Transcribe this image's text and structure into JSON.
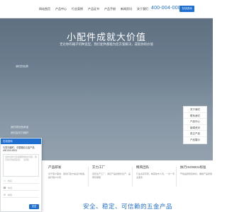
{
  "nav": {
    "items": [
      "网站首页",
      "产品中心",
      "行业案例",
      "产品证书",
      "产品手册",
      "新闻资讯",
      "关于我们"
    ],
    "phone": "400-004-0003",
    "online_button": "在线咨询"
  },
  "hero": {
    "title": "小配件成就大价值",
    "subtitle": "无论你的箱子何种造型，我们配件都能为您方案解决，成就你的价值",
    "lines": [
      "我们的优势",
      "我们将仍然承诺",
      "我们会尽力做好"
    ]
  },
  "float_menu": [
    "关于我们",
    "联系我们",
    "产品中心",
    "新闻资讯",
    "真正产品",
    "产品展示"
  ],
  "chat": {
    "title": "在线咨询",
    "greeting": "与您沟通时，中国箱包五金产品",
    "phone": "400-004-0003",
    "message_placeholder": "请告诉我们您需要帮助的问题，我们将尽快回复您！（必填）",
    "name_placeholder": "姓名",
    "phone_placeholder": "电话",
    "email_placeholder": "邮箱",
    "send_label": "发送"
  },
  "features": [
    {
      "title": "产品研发",
      "desc": "基于客户需求，量身打造方案设计制造，提升客户价值"
    },
    {
      "title": "实力工厂",
      "desc": "自有生产工厂，满足产品批量化生产，品质有保障"
    },
    {
      "title": "精英团队",
      "desc": "行业资深专家，精英技术人员，一对一专业服务"
    },
    {
      "title": "执行ISO9001标准",
      "desc": "严格品质把控体系，确保产品质量"
    }
  ],
  "slogan": "安全、稳定、可信赖的五金产品"
}
